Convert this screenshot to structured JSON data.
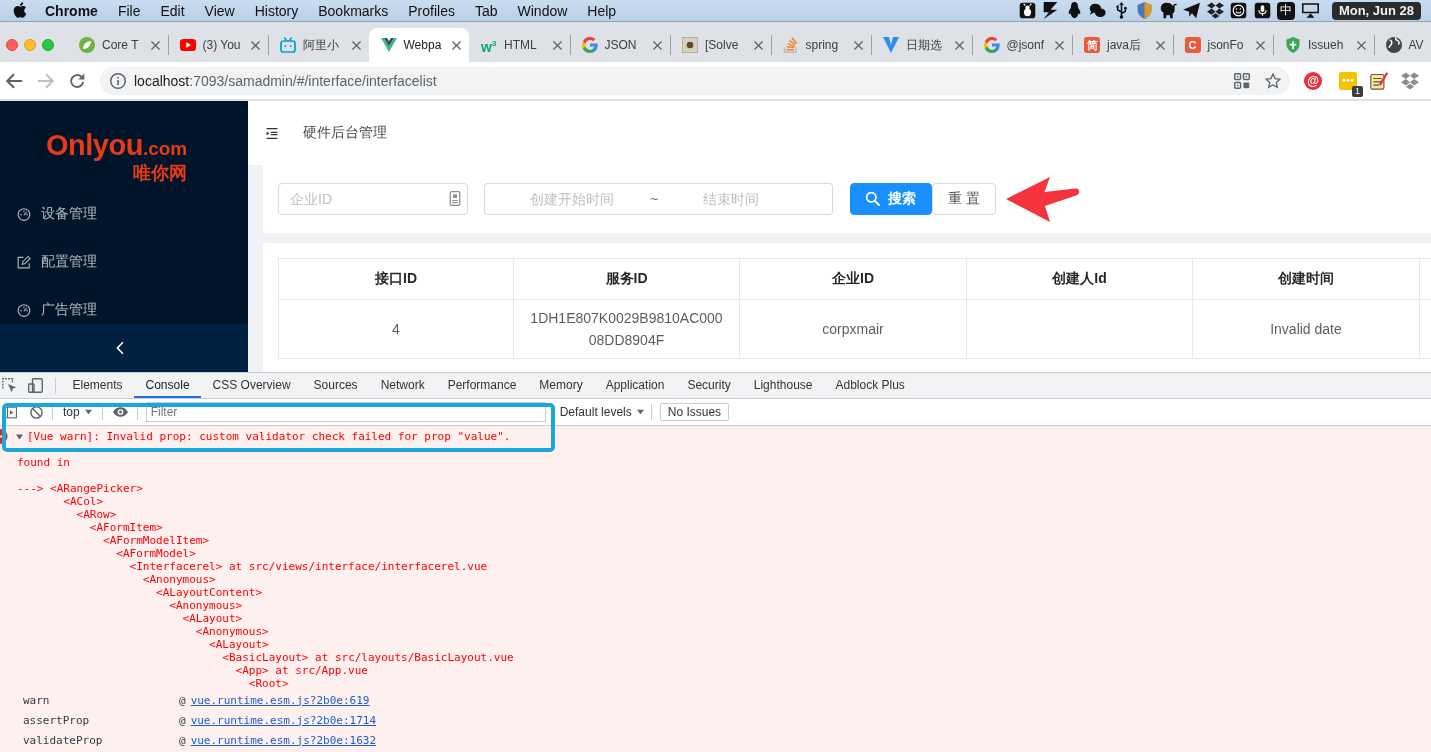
{
  "menu_bar": {
    "app": "Chrome",
    "menus": [
      "File",
      "Edit",
      "View",
      "History",
      "Bookmarks",
      "Profiles",
      "Tab",
      "Window",
      "Help"
    ],
    "status_items": [
      {
        "kind": "bug"
      },
      {
        "kind": "lightning"
      },
      {
        "kind": "penguin"
      },
      {
        "kind": "chat"
      },
      {
        "kind": "usb"
      },
      {
        "kind": "shield"
      },
      {
        "kind": "elephant"
      },
      {
        "kind": "plane"
      },
      {
        "kind": "diamonds"
      },
      {
        "kind": "smiley"
      },
      {
        "kind": "mic"
      },
      {
        "kind": "text",
        "text": "中"
      },
      {
        "kind": "display"
      }
    ],
    "clock": "Mon, Jun 28"
  },
  "browser_tabs": [
    {
      "title": "Core T",
      "kind": "leaf",
      "selected": false
    },
    {
      "title": "(3) You",
      "kind": "play",
      "selected": false
    },
    {
      "title": "阿里小",
      "kind": "tv",
      "selected": false
    },
    {
      "title": "Webpa",
      "kind": "v",
      "selected": true
    },
    {
      "title": "HTML",
      "kind": "letter",
      "favicon_text": "w$^{3}$",
      "selected": false
    },
    {
      "title": "JSON",
      "kind": "g",
      "selected": false
    },
    {
      "title": "[Solve",
      "kind": "photo",
      "selected": false
    },
    {
      "title": "spring",
      "kind": "stack",
      "selected": false
    },
    {
      "title": "日期选",
      "kind": "v-mark",
      "selected": false
    },
    {
      "title": "@jsonf",
      "kind": "g",
      "selected": false
    },
    {
      "title": "java后",
      "kind": "tile",
      "favicon_text": "简",
      "selected": false
    },
    {
      "title": "jsonFo",
      "kind": "tile",
      "favicon_text": "C",
      "selected": false
    },
    {
      "title": "Issueh",
      "kind": "shield",
      "selected": false
    },
    {
      "title": "AV",
      "kind": "globe",
      "selected": false
    }
  ],
  "toolbar": {
    "nav_buttons": [
      {
        "kind": "back",
        "disabled": false
      },
      {
        "kind": "forward",
        "disabled": true
      },
      {
        "kind": "reload",
        "disabled": false
      }
    ],
    "address": {
      "host": "localhost",
      "path": ":7093/samadmin/#/interface/interfacelist"
    },
    "extensions": [
      {
        "kind": "at",
        "text": "@"
      },
      {
        "kind": "dots",
        "badge": "1"
      },
      {
        "kind": "notepad"
      },
      {
        "kind": "diamonds"
      }
    ]
  },
  "app": {
    "logo": {
      "name": "Onlyou",
      "domain": ".com",
      "tagline": "唯你网"
    },
    "sidebar": {
      "items": [
        {
          "label": "设备管理",
          "kind": "gauge",
          "selected": false
        },
        {
          "label": "配置管理",
          "kind": "edit",
          "selected": false
        },
        {
          "label": "广告管理",
          "kind": "gauge",
          "selected": false
        }
      ]
    },
    "header": {
      "title": "硬件后台管理"
    },
    "search_form": {
      "company_id": {
        "placeholder": "企业ID"
      },
      "date_range": {
        "start_placeholder": "创建开始时间",
        "separator": "~",
        "end_placeholder": "结束时间"
      },
      "buttons": [
        {
          "label": "搜索",
          "kind": "primary"
        },
        {
          "label": "重 置",
          "kind": "default"
        }
      ]
    },
    "table": {
      "columns": [
        "接口ID",
        "服务ID",
        "企业ID",
        "创建人Id",
        "创建时间"
      ],
      "rows": [
        {
          "cells": [
            "4",
            "1DH1E807K0029B9810AC00008DD8904F",
            "corpxmair",
            null,
            "Invalid date"
          ]
        }
      ]
    }
  },
  "devtools": {
    "tabs": [
      {
        "label": "Elements",
        "selected": false
      },
      {
        "label": "Console",
        "selected": true
      },
      {
        "label": "CSS Overview",
        "selected": false
      },
      {
        "label": "Sources",
        "selected": false
      },
      {
        "label": "Network",
        "selected": false
      },
      {
        "label": "Performance",
        "selected": false
      },
      {
        "label": "Memory",
        "selected": false
      },
      {
        "label": "Application",
        "selected": false
      },
      {
        "label": "Security",
        "selected": false
      },
      {
        "label": "Lighthouse",
        "selected": false
      },
      {
        "label": "Adblock Plus",
        "selected": false
      }
    ],
    "console_toolbar": {
      "context": "top",
      "filter_placeholder": "Filter",
      "levels": "Default levels",
      "issues": "No Issues"
    },
    "console": {
      "error": {
        "expanded": true,
        "text": "[Vue warn]: Invalid prop: custom validator check failed for prop \"value\"."
      },
      "found_in": "found in",
      "trace_marker": "--->",
      "component_tree": {
        "text": "<ARangePicker>",
        "children": [
          {
            "text": "<ACol>",
            "children": [
              {
                "text": "<ARow>",
                "children": [
                  {
                    "text": "<AFormItem>",
                    "children": [
                      {
                        "text": "<AFormModelItem>",
                        "children": [
                          {
                            "text": "<AFormModel>",
                            "children": [
                              {
                                "text": "<Interfacerel> at src/views/interface/interfacerel.vue",
                                "children": [
                                  {
                                    "text": "<Anonymous>",
                                    "children": [
                                      {
                                        "text": "<ALayoutContent>",
                                        "children": [
                                          {
                                            "text": "<Anonymous>",
                                            "children": [
                                              {
                                                "text": "<ALayout>",
                                                "children": [
                                                  {
                                                    "text": "<Anonymous>",
                                                    "children": [
                                                      {
                                                        "text": "<ALayout>",
                                                        "children": [
                                                          {
                                                            "text": "<BasicLayout> at src/layouts/BasicLayout.vue",
                                                            "children": [
                                                              {
                                                                "text": "<App> at src/App.vue",
                                                                "children": [
                                                                  {
                                                                    "text": "<Root>"
                                                                  }
                                                                ]
                                                              }
                                                            ]
                                                          }
                                                        ]
                                                      }
                                                    ]
                                                  }
                                                ]
                                              }
                                            ]
                                          }
                                        ]
                                      }
                                    ]
                                  }
                                ]
                              }
                            ]
                          }
                        ]
                      }
                    ]
                  }
                ]
              }
            ]
          }
        ]
      },
      "stack": [
        {
          "function": "warn",
          "at": "@",
          "location": "vue.runtime.esm.js?2b0e:619"
        },
        {
          "function": "assertProp",
          "at": "@",
          "location": "vue.runtime.esm.js?2b0e:1714"
        },
        {
          "function": "validateProp",
          "at": "@",
          "location": "vue.runtime.esm.js?2b0e:1632"
        }
      ]
    }
  }
}
